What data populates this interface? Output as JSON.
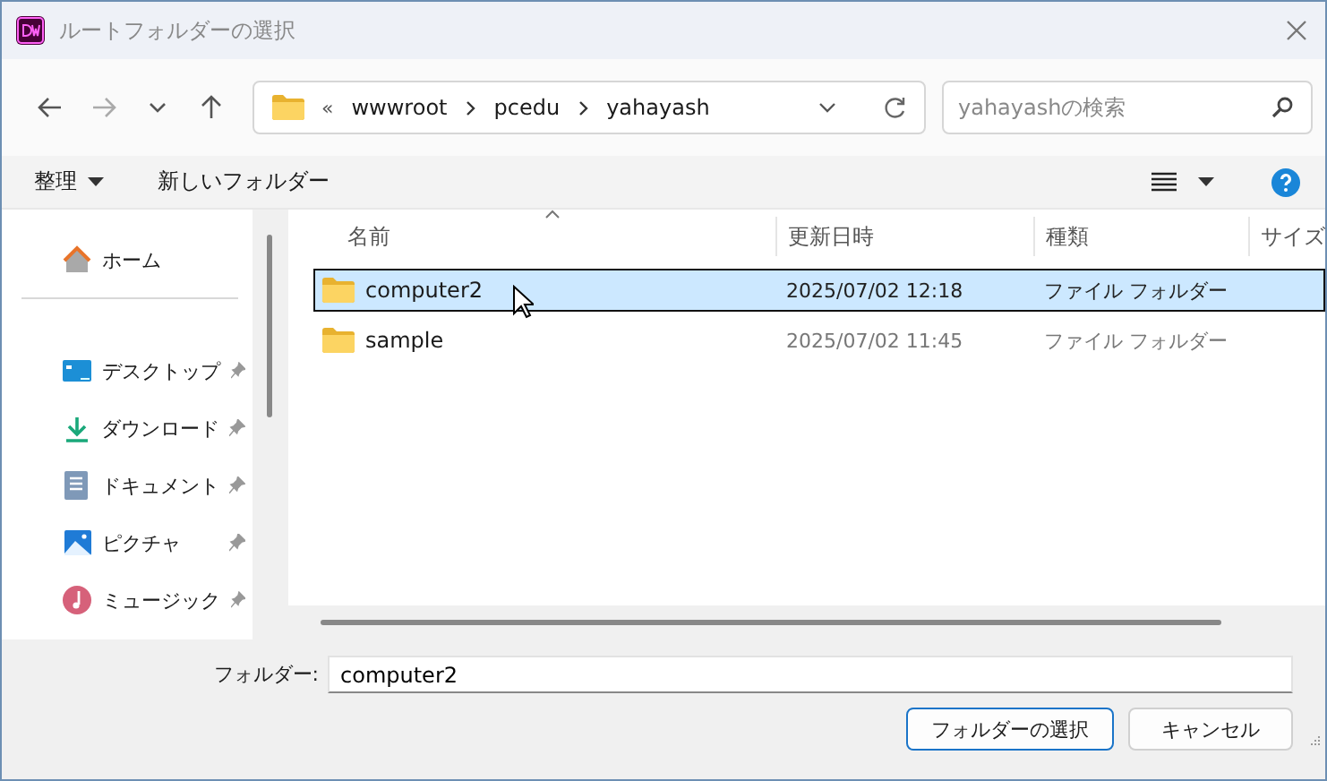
{
  "window": {
    "title": "ルートフォルダーの選択"
  },
  "navigation": {
    "overflow": "«",
    "breadcrumb": [
      "wwwroot",
      "pcedu",
      "yahayash"
    ],
    "search": {
      "placeholder": "yahayashの検索"
    }
  },
  "toolbar": {
    "organize": "整理",
    "new_folder": "新しいフォルダー"
  },
  "sidebar": {
    "items": [
      {
        "kind": "home",
        "label": "ホーム",
        "pinned": false
      },
      {
        "kind": "desktop",
        "label": "デスクトップ",
        "pinned": true
      },
      {
        "kind": "downloads",
        "label": "ダウンロード",
        "pinned": true
      },
      {
        "kind": "documents",
        "label": "ドキュメント",
        "pinned": true
      },
      {
        "kind": "pictures",
        "label": "ピクチャ",
        "pinned": true
      },
      {
        "kind": "music",
        "label": "ミュージック",
        "pinned": true
      }
    ]
  },
  "table": {
    "columns": [
      "名前",
      "更新日時",
      "種類",
      "サイズ"
    ],
    "rows": [
      {
        "name": "computer2",
        "modified": "2025/07/02 12:18",
        "type": "ファイル フォルダー",
        "selected": true
      },
      {
        "name": "sample",
        "modified": "2025/07/02 11:45",
        "type": "ファイル フォルダー",
        "selected": false
      }
    ]
  },
  "footer": {
    "label": "フォルダー:",
    "value": "computer2",
    "buttons": [
      "フォルダーの選択",
      "キャンセル"
    ]
  }
}
